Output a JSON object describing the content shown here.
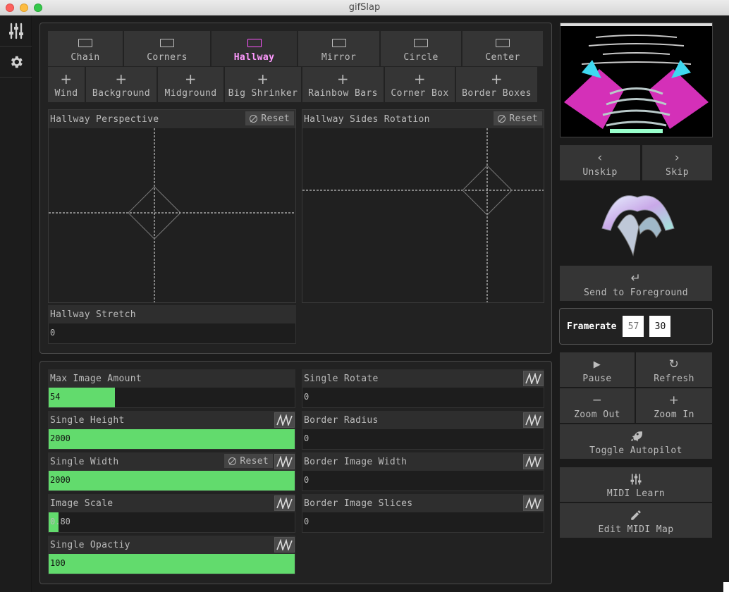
{
  "window": {
    "title": "gifSlap"
  },
  "sidebar": {
    "items": [
      {
        "icon": "sliders-icon"
      },
      {
        "icon": "gear-icon"
      }
    ]
  },
  "layers": {
    "row1": [
      {
        "label": "Chain",
        "icon": "rect-icon",
        "active": false
      },
      {
        "label": "Corners",
        "icon": "rect-icon",
        "active": false
      },
      {
        "label": "Hallway",
        "icon": "rect-icon",
        "active": true
      },
      {
        "label": "Mirror",
        "icon": "rect-icon",
        "active": false
      },
      {
        "label": "Circle",
        "icon": "rect-icon",
        "active": false
      },
      {
        "label": "Center",
        "icon": "rect-icon",
        "active": false
      }
    ],
    "row2": [
      {
        "label": "Wind",
        "icon": "plus-icon"
      },
      {
        "label": "Background",
        "icon": "plus-icon"
      },
      {
        "label": "Midground",
        "icon": "plus-icon"
      },
      {
        "label": "Big Shrinker",
        "icon": "plus-icon"
      },
      {
        "label": "Rainbow Bars",
        "icon": "plus-icon"
      },
      {
        "label": "Corner Box",
        "icon": "plus-icon"
      },
      {
        "label": "Border Boxes",
        "icon": "plus-icon"
      }
    ]
  },
  "pads": {
    "perspective": {
      "label": "Hallway Perspective",
      "reset": "Reset"
    },
    "sides_rotation": {
      "label": "Hallway Sides Rotation",
      "reset": "Reset"
    },
    "stretch": {
      "label": "Hallway Stretch",
      "value": "0"
    }
  },
  "sliders": {
    "max_image_amount": {
      "label": "Max Image Amount",
      "value": "54",
      "fill": 0.27
    },
    "single_height": {
      "label": "Single Height",
      "value": "2000",
      "fill": 1.0
    },
    "single_width": {
      "label": "Single Width",
      "value": "2000",
      "fill": 1.0,
      "reset": "Reset"
    },
    "image_scale": {
      "label": "Image Scale",
      "value": "0.80",
      "fill": 0.04
    },
    "single_opacity": {
      "label": "Single Opactiy",
      "value": "100",
      "fill": 1.0
    },
    "single_rotate": {
      "label": "Single Rotate",
      "value": "0",
      "fill": 0
    },
    "border_radius": {
      "label": "Border Radius",
      "value": "0",
      "fill": 0
    },
    "border_image_width": {
      "label": "Border Image Width",
      "value": "0",
      "fill": 0
    },
    "border_image_slices": {
      "label": "Border Image Slices",
      "value": "0",
      "fill": 0
    }
  },
  "controls": {
    "unskip": "Unskip",
    "skip": "Skip",
    "send_to_foreground": "Send to Foreground",
    "framerate_label": "Framerate",
    "framerate_value": "57",
    "framerate_target": "30",
    "pause": "Pause",
    "refresh": "Refresh",
    "zoom_out": "Zoom Out",
    "zoom_in": "Zoom In",
    "toggle_autopilot": "Toggle Autopilot",
    "midi_learn": "MIDI Learn",
    "edit_midi_map": "Edit MIDI Map"
  },
  "colors": {
    "accent_active": "#ff55ff",
    "slider_fill": "#62db6d",
    "background": "#1b1b1b"
  }
}
